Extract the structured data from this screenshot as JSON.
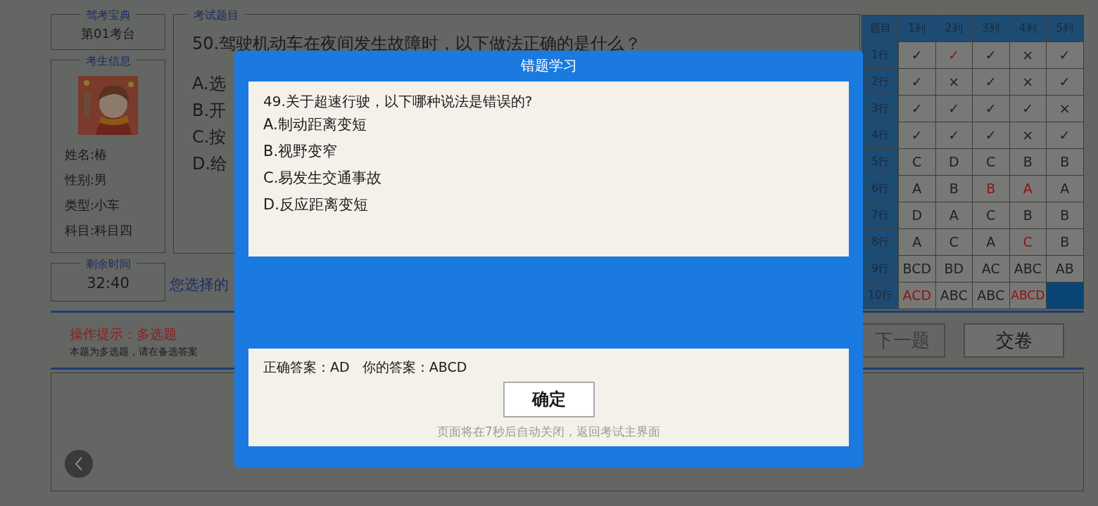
{
  "exam_station": {
    "legend": "驾考宝典",
    "value": "第01考台"
  },
  "candidate": {
    "legend": "考生信息",
    "fields": [
      "姓名:椿",
      "性别:男",
      "类型:小车",
      "科目:科目四"
    ]
  },
  "time_left": {
    "legend": "剩余时间",
    "value": "32:40"
  },
  "question": {
    "legend": "考试题目",
    "text": "50.驾驶机动车在夜间发生故障时，以下做法正确的是什么？",
    "options": [
      "A.选",
      "B.开",
      "C.按",
      "D.给"
    ],
    "your_choice": "您选择的"
  },
  "answer_grid": {
    "corner": "题目",
    "columns": [
      "1列",
      "2列",
      "3列",
      "4列",
      "5列"
    ],
    "rows": [
      {
        "label": "1行",
        "cells": [
          {
            "text": "✓",
            "wrong": false,
            "current": false
          },
          {
            "text": "✓",
            "wrong": true,
            "current": false
          },
          {
            "text": "✓",
            "wrong": false,
            "current": false
          },
          {
            "text": "×",
            "wrong": false,
            "current": false
          },
          {
            "text": "✓",
            "wrong": false,
            "current": false
          }
        ]
      },
      {
        "label": "2行",
        "cells": [
          {
            "text": "✓",
            "wrong": false,
            "current": false
          },
          {
            "text": "×",
            "wrong": false,
            "current": false
          },
          {
            "text": "✓",
            "wrong": false,
            "current": false
          },
          {
            "text": "×",
            "wrong": false,
            "current": false
          },
          {
            "text": "✓",
            "wrong": false,
            "current": false
          }
        ]
      },
      {
        "label": "3行",
        "cells": [
          {
            "text": "✓",
            "wrong": false,
            "current": false
          },
          {
            "text": "✓",
            "wrong": false,
            "current": false
          },
          {
            "text": "✓",
            "wrong": false,
            "current": false
          },
          {
            "text": "✓",
            "wrong": false,
            "current": false
          },
          {
            "text": "×",
            "wrong": false,
            "current": false
          }
        ]
      },
      {
        "label": "4行",
        "cells": [
          {
            "text": "✓",
            "wrong": false,
            "current": false
          },
          {
            "text": "✓",
            "wrong": false,
            "current": false
          },
          {
            "text": "✓",
            "wrong": false,
            "current": false
          },
          {
            "text": "×",
            "wrong": false,
            "current": false
          },
          {
            "text": "✓",
            "wrong": false,
            "current": false
          }
        ]
      },
      {
        "label": "5行",
        "cells": [
          {
            "text": "C",
            "wrong": false,
            "current": false
          },
          {
            "text": "D",
            "wrong": false,
            "current": false
          },
          {
            "text": "C",
            "wrong": false,
            "current": false
          },
          {
            "text": "B",
            "wrong": false,
            "current": false
          },
          {
            "text": "B",
            "wrong": false,
            "current": false
          }
        ]
      },
      {
        "label": "6行",
        "cells": [
          {
            "text": "A",
            "wrong": false,
            "current": false
          },
          {
            "text": "B",
            "wrong": false,
            "current": false
          },
          {
            "text": "B",
            "wrong": true,
            "current": false
          },
          {
            "text": "A",
            "wrong": true,
            "current": false
          },
          {
            "text": "A",
            "wrong": false,
            "current": false
          }
        ]
      },
      {
        "label": "7行",
        "cells": [
          {
            "text": "D",
            "wrong": false,
            "current": false
          },
          {
            "text": "A",
            "wrong": false,
            "current": false
          },
          {
            "text": "C",
            "wrong": false,
            "current": false
          },
          {
            "text": "B",
            "wrong": false,
            "current": false
          },
          {
            "text": "B",
            "wrong": false,
            "current": false
          }
        ]
      },
      {
        "label": "8行",
        "cells": [
          {
            "text": "A",
            "wrong": false,
            "current": false
          },
          {
            "text": "C",
            "wrong": false,
            "current": false
          },
          {
            "text": "A",
            "wrong": false,
            "current": false
          },
          {
            "text": "C",
            "wrong": true,
            "current": false
          },
          {
            "text": "B",
            "wrong": false,
            "current": false
          }
        ]
      },
      {
        "label": "9行",
        "cells": [
          {
            "text": "BCD",
            "wrong": false,
            "current": false
          },
          {
            "text": "BD",
            "wrong": false,
            "current": false
          },
          {
            "text": "AC",
            "wrong": false,
            "current": false
          },
          {
            "text": "ABC",
            "wrong": false,
            "current": false
          },
          {
            "text": "AB",
            "wrong": false,
            "current": false
          }
        ]
      },
      {
        "label": "10行",
        "cells": [
          {
            "text": "ACD",
            "wrong": true,
            "current": false
          },
          {
            "text": "ABC",
            "wrong": false,
            "current": false
          },
          {
            "text": "ABC",
            "wrong": false,
            "current": false
          },
          {
            "text": "ABCD",
            "wrong": true,
            "current": false
          },
          {
            "current": true
          }
        ]
      }
    ]
  },
  "hint": {
    "title": "操作提示：多选题",
    "text": "本题为多选题，请在备选答案"
  },
  "buttons": [
    "下一题",
    "交卷"
  ],
  "dialog": {
    "title": "错题学习",
    "question": "49.关于超速行驶，以下哪种说法是错误的?",
    "options": [
      "A.制动距离变短",
      "B.视野变窄",
      "C.易发生交通事故",
      "D.反应距离变短"
    ],
    "result": "正确答案：AD   你的答案：ABCD",
    "confirm": "确定",
    "note": "页面将在7秒后自动关闭，返回考试主界面"
  }
}
